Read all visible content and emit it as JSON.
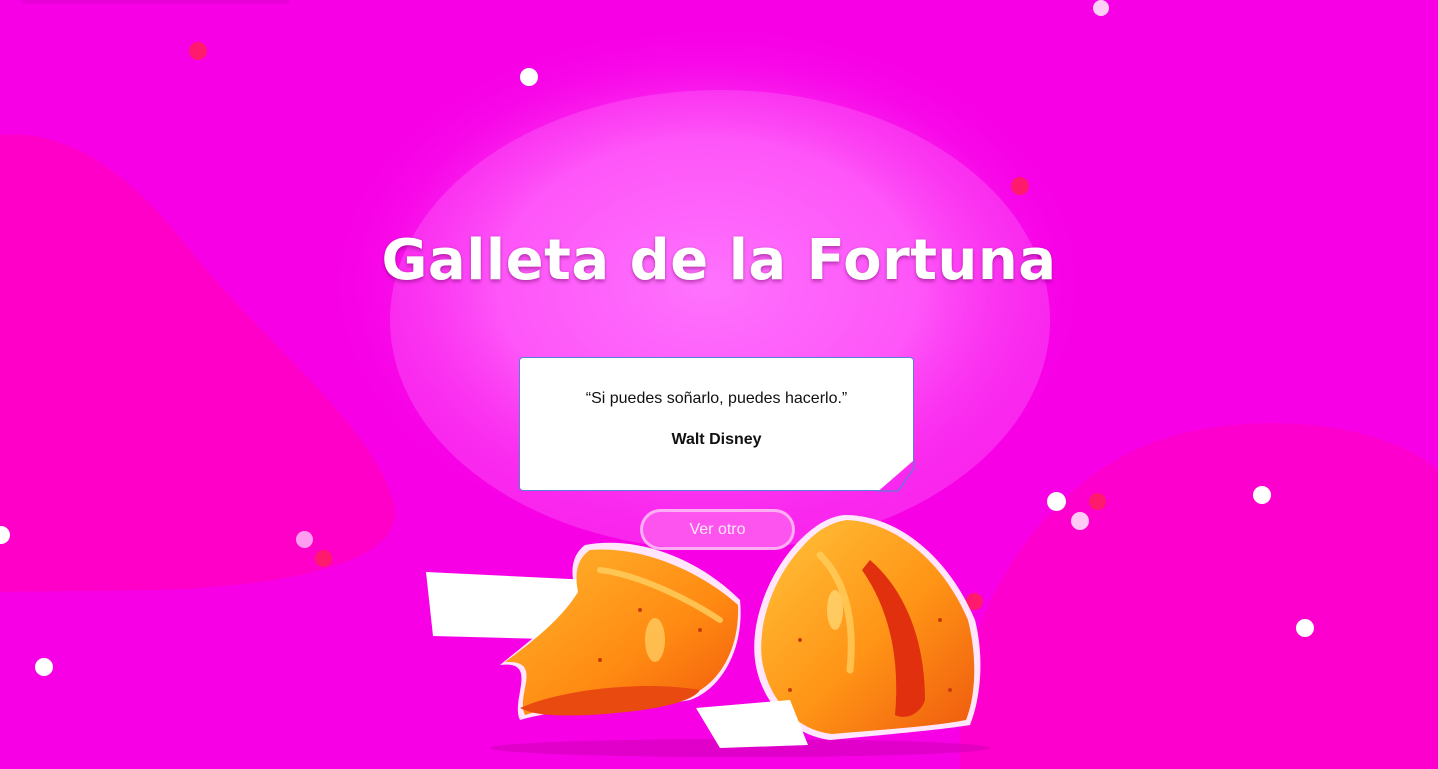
{
  "title": "Galleta de la Fortuna",
  "quote": {
    "text": "“Si puedes soñarlo, puedes hacerlo.”",
    "author": "Walt Disney"
  },
  "button": {
    "label": "Ver otro"
  },
  "colors": {
    "background": "#f700e6",
    "card": "#ffffff",
    "card_border": "#5a7fd6",
    "cookie_orange": "#ff9a1a",
    "cookie_dark": "#e8420e",
    "dot_pink": "#ff1a6e",
    "dot_white": "#ffffff"
  },
  "illustration": {
    "name": "fortune-cookies-illustration"
  }
}
